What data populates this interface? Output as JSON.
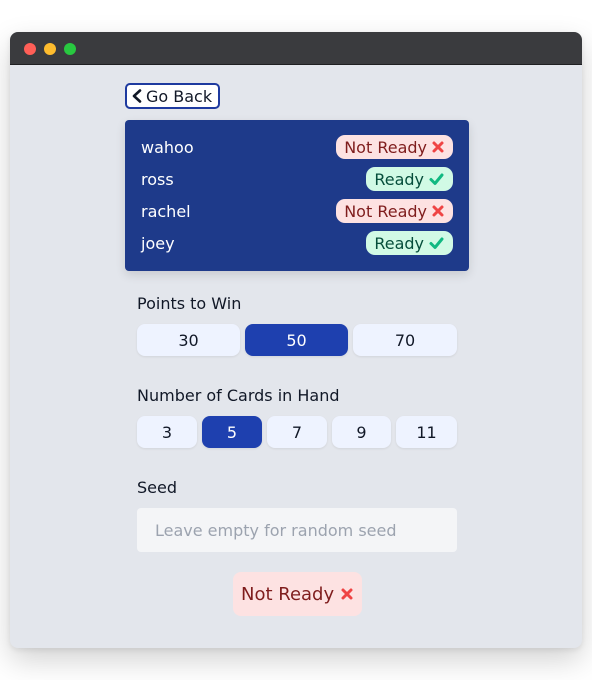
{
  "navigation": {
    "back_label": "Go Back"
  },
  "players": [
    {
      "name": "wahoo",
      "status": "Not Ready",
      "ready": false
    },
    {
      "name": "ross",
      "status": "Ready",
      "ready": true
    },
    {
      "name": "rachel",
      "status": "Not Ready",
      "ready": false
    },
    {
      "name": "joey",
      "status": "Ready",
      "ready": true
    }
  ],
  "points_to_win": {
    "label": "Points to Win",
    "options": [
      "30",
      "50",
      "70"
    ],
    "selected": "50"
  },
  "cards_in_hand": {
    "label": "Number of Cards in Hand",
    "options": [
      "3",
      "5",
      "7",
      "9",
      "11"
    ],
    "selected": "5"
  },
  "seed": {
    "label": "Seed",
    "placeholder": "Leave empty for random seed",
    "value": ""
  },
  "self_status": {
    "label": "Not Ready",
    "ready": false
  },
  "colors": {
    "accent": "#1e40af",
    "panel": "#1e3a8a",
    "ready_bg": "#d1fae5",
    "not_ready_bg": "#fde2e2",
    "check": "#10b981",
    "cross": "#ef4444"
  }
}
